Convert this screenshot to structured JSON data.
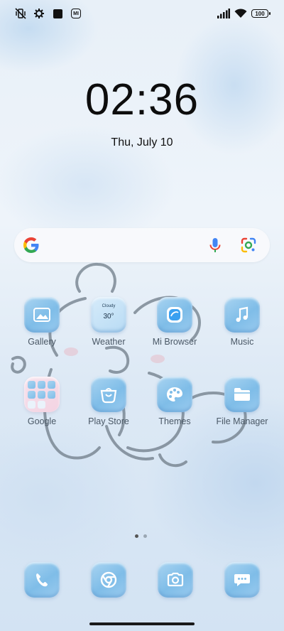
{
  "status_bar": {
    "left_icons": [
      "vibrate-off-icon",
      "settings-gear-icon",
      "square-notification-icon",
      "mi-icon"
    ],
    "mi_badge": "MI",
    "battery": "100",
    "right_icons": [
      "signal-icon",
      "wifi-icon",
      "battery-icon"
    ]
  },
  "clock": {
    "time": "02:36",
    "date": "Thu, July 10"
  },
  "search": {
    "icons": [
      "google-logo-icon",
      "mic-icon",
      "google-lens-icon"
    ]
  },
  "apps": [
    {
      "label": "Gallery",
      "icon": "gallery-icon"
    },
    {
      "label": "Weather",
      "icon": "weather-icon",
      "condition": "Cloudy",
      "temp": "30°"
    },
    {
      "label": "Mi Browser",
      "icon": "browser-icon"
    },
    {
      "label": "Music",
      "icon": "music-icon"
    },
    {
      "label": "Google",
      "icon": "folder-icon"
    },
    {
      "label": "Play Store",
      "icon": "play-store-icon"
    },
    {
      "label": "Themes",
      "icon": "themes-icon"
    },
    {
      "label": "File Manager",
      "icon": "file-manager-icon"
    }
  ],
  "page_indicator": {
    "pages": 2,
    "current": 1
  },
  "dock": [
    {
      "icon": "phone-icon"
    },
    {
      "icon": "chrome-icon"
    },
    {
      "icon": "camera-icon"
    },
    {
      "icon": "messages-icon"
    }
  ],
  "colors": {
    "icon_blue": "#7fbde8",
    "label": "#4a5866",
    "accent_blue": "#4285f4"
  }
}
